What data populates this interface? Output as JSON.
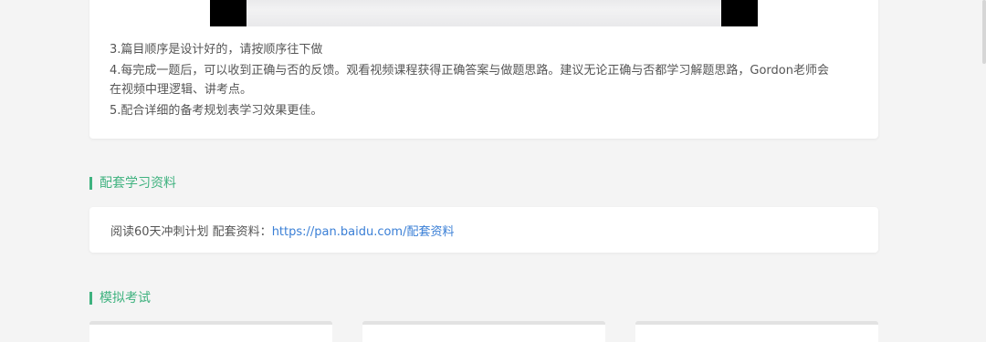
{
  "instructions": {
    "item3": "3.篇目顺序是设计好的，请按顺序往下做",
    "item4_line1": "4.每完成一题后，可以收到正确与否的反馈。观看视频课程获得正确答案与做题思路。建议无论正确与否都学习解题思路，Gordon老师会",
    "item4_line2": "在视频中理逻辑、讲考点。",
    "item5": "5.配合详细的备考规划表学习效果更佳。"
  },
  "materials_section": {
    "title": "配套学习资料",
    "label": "阅读60天冲刺计划 配套资料：",
    "link_text": "https://pan.baidu.com/配套资料"
  },
  "exam_section": {
    "title": "模拟考试"
  },
  "colors": {
    "accent": "#3fb27f",
    "link": "#3a7fd6",
    "background": "#f4f4f4"
  }
}
